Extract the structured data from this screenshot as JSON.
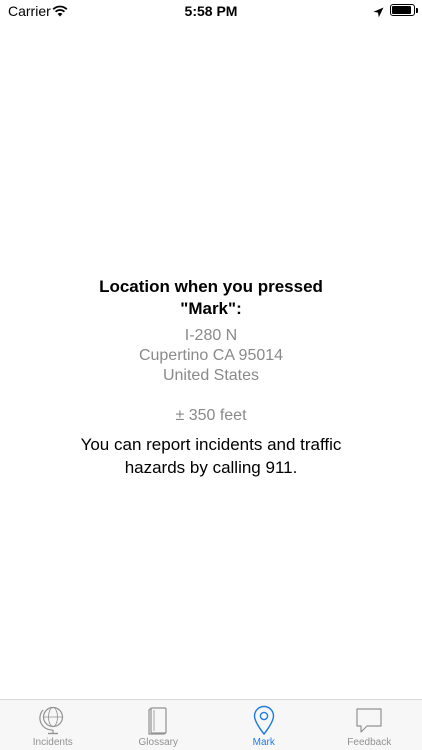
{
  "status": {
    "carrier": "Carrier",
    "time": "5:58 PM",
    "battery_level": 0.9
  },
  "content": {
    "heading": "Location when you pressed \"Mark\":",
    "address_lines": [
      "I-280 N",
      "Cupertino CA 95014",
      "United States"
    ],
    "accuracy": "± 350 feet",
    "note": "You can report incidents and traffic hazards by calling 911."
  },
  "tabbar": {
    "active": "Mark",
    "active_color": "#1e7ce2",
    "inactive_color": "#929292",
    "tabs": [
      {
        "label": "Incidents",
        "icon": "globe-icon"
      },
      {
        "label": "Glossary",
        "icon": "book-icon"
      },
      {
        "label": "Mark",
        "icon": "location-pin-icon"
      },
      {
        "label": "Feedback",
        "icon": "speech-bubble-icon"
      }
    ]
  }
}
